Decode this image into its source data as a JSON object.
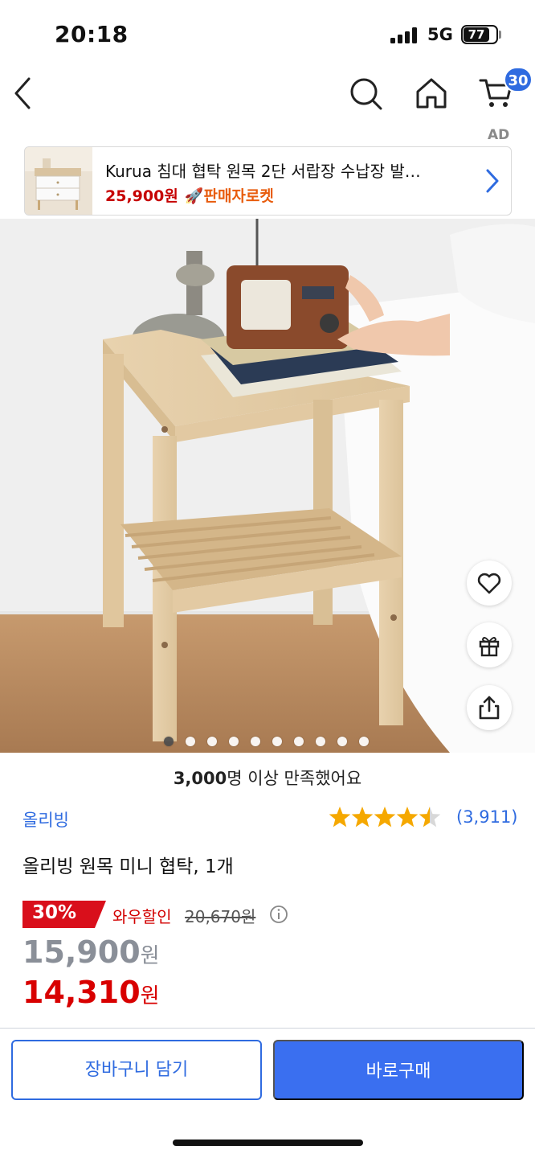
{
  "status_bar": {
    "time": "20:18",
    "network": "5G",
    "battery": "77"
  },
  "nav": {
    "cart_count": "30"
  },
  "ad": {
    "label": "AD",
    "title": "Kurua 침대 협탁 원목 2단 서랍장 수납장 발…",
    "price": "25,900원",
    "badge": "🚀판매자로켓"
  },
  "gallery": {
    "image_count": 10,
    "active_index": 0
  },
  "product": {
    "satisfaction_bold": "3,000",
    "satisfaction_rest": "명 이상 만족했어요",
    "brand": "올리빙",
    "rating": 4.5,
    "review_count": "(3,911)",
    "title": "올리빙 원목 미니 협탁, 1개",
    "discount_percent": "30%",
    "wow_label": "와우할인",
    "original_price": "20,670원",
    "price_main": "15,900",
    "price_wow": "14,310",
    "currency": "원"
  },
  "actions": {
    "cart_button": "장바구니 담기",
    "buy_button": "바로구매"
  },
  "colors": {
    "accent": "#2f6be0",
    "sale": "#d80000",
    "rocket": "#e85c0d",
    "star": "#f5a800"
  },
  "icons": [
    "back-icon",
    "search-icon",
    "home-icon",
    "cart-icon",
    "chevron-right-icon",
    "heart-icon",
    "gift-icon",
    "share-icon",
    "info-icon",
    "star-icon"
  ]
}
